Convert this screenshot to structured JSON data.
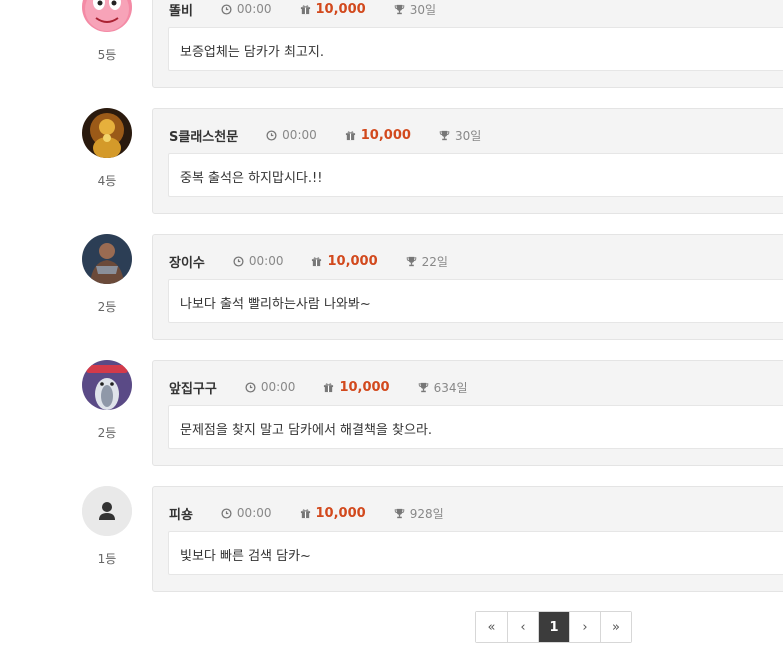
{
  "entries": [
    {
      "nickname": "똘비",
      "time": "00:00",
      "point": "10,000",
      "days": "30일",
      "message": "보증업체는 담카가 최고지.",
      "rank": "5등",
      "avatar": "pink-face"
    },
    {
      "nickname": "S클래스천문",
      "time": "00:00",
      "point": "10,000",
      "days": "30일",
      "message": "중복 출석은 하지맙시다.!!",
      "rank": "4등",
      "avatar": "golden-buddha"
    },
    {
      "nickname": "장이수",
      "time": "00:00",
      "point": "10,000",
      "days": "22일",
      "message": "나보다 출석 빨리하는사람 나와봐~",
      "rank": "2등",
      "avatar": "warrior"
    },
    {
      "nickname": "앞집구구",
      "time": "00:00",
      "point": "10,000",
      "days": "634일",
      "message": "문제점을 찾지 말고 담카에서 해결책을 찾으라.",
      "rank": "2등",
      "avatar": "bird"
    },
    {
      "nickname": "피숑",
      "time": "00:00",
      "point": "10,000",
      "days": "928일",
      "message": "빛보다 빠른 검색 담카~",
      "rank": "1등",
      "avatar": "default-user"
    }
  ],
  "pagination": {
    "first": "«",
    "prev": "‹",
    "current": "1",
    "next": "›",
    "last": "»"
  },
  "colors": {
    "point": "#d2491d",
    "active_page": "#3c3c3c"
  },
  "icons": {
    "time": "clock-icon",
    "point": "gift-icon",
    "days": "trophy-icon"
  }
}
